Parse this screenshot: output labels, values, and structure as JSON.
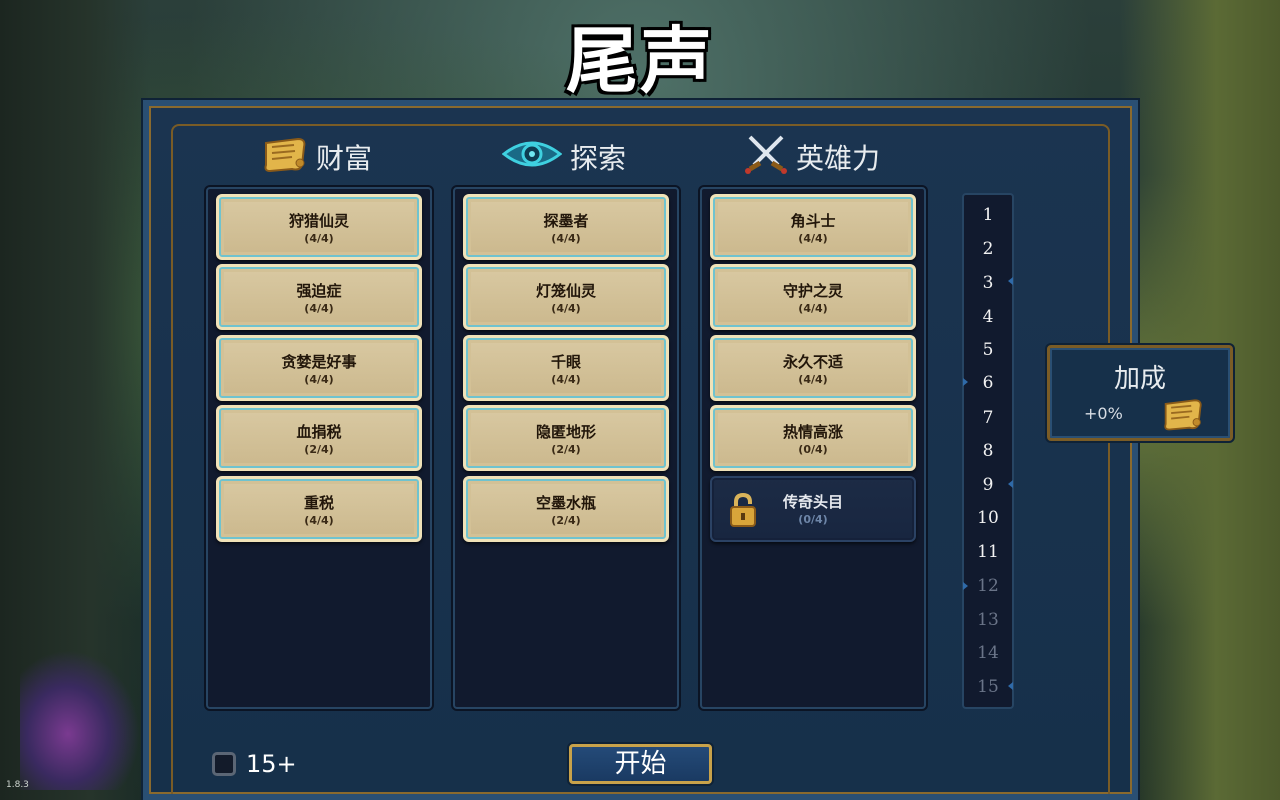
{
  "title": "尾声",
  "version": "1.8.3",
  "columns": [
    {
      "header": "财富",
      "icon": "scroll-icon",
      "cards": [
        {
          "name": "狩猎仙灵",
          "count": "(4/4)"
        },
        {
          "name": "强迫症",
          "count": "(4/4)"
        },
        {
          "name": "贪婪是好事",
          "count": "(4/4)"
        },
        {
          "name": "血捐税",
          "count": "(2/4)"
        },
        {
          "name": "重税",
          "count": "(4/4)"
        }
      ]
    },
    {
      "header": "探索",
      "icon": "eye-icon",
      "cards": [
        {
          "name": "探墨者",
          "count": "(4/4)"
        },
        {
          "name": "灯笼仙灵",
          "count": "(4/4)"
        },
        {
          "name": "千眼",
          "count": "(4/4)"
        },
        {
          "name": "隐匿地形",
          "count": "(2/4)"
        },
        {
          "name": "空墨水瓶",
          "count": "(2/4)"
        }
      ]
    },
    {
      "header": "英雄力",
      "icon": "crossed-swords-icon",
      "cards": [
        {
          "name": "角斗士",
          "count": "(4/4)"
        },
        {
          "name": "守护之灵",
          "count": "(4/4)"
        },
        {
          "name": "永久不适",
          "count": "(4/4)"
        },
        {
          "name": "热情高涨",
          "count": "(0/4)"
        },
        {
          "name": "传奇头目",
          "count": "(0/4)",
          "locked": true
        }
      ]
    }
  ],
  "levels": [
    "1",
    "2",
    "3",
    "4",
    "5",
    "6",
    "7",
    "8",
    "9",
    "10",
    "11",
    "12",
    "13",
    "14",
    "15"
  ],
  "levels_unlocked": 11,
  "bonus": {
    "title": "加成",
    "value": "+0%"
  },
  "checkbox": {
    "label": "15+",
    "checked": false
  },
  "start_label": "开始",
  "colors": {
    "card_border": "#6fc3cf",
    "gold": "#c8a24a",
    "panel": "#16304a"
  }
}
